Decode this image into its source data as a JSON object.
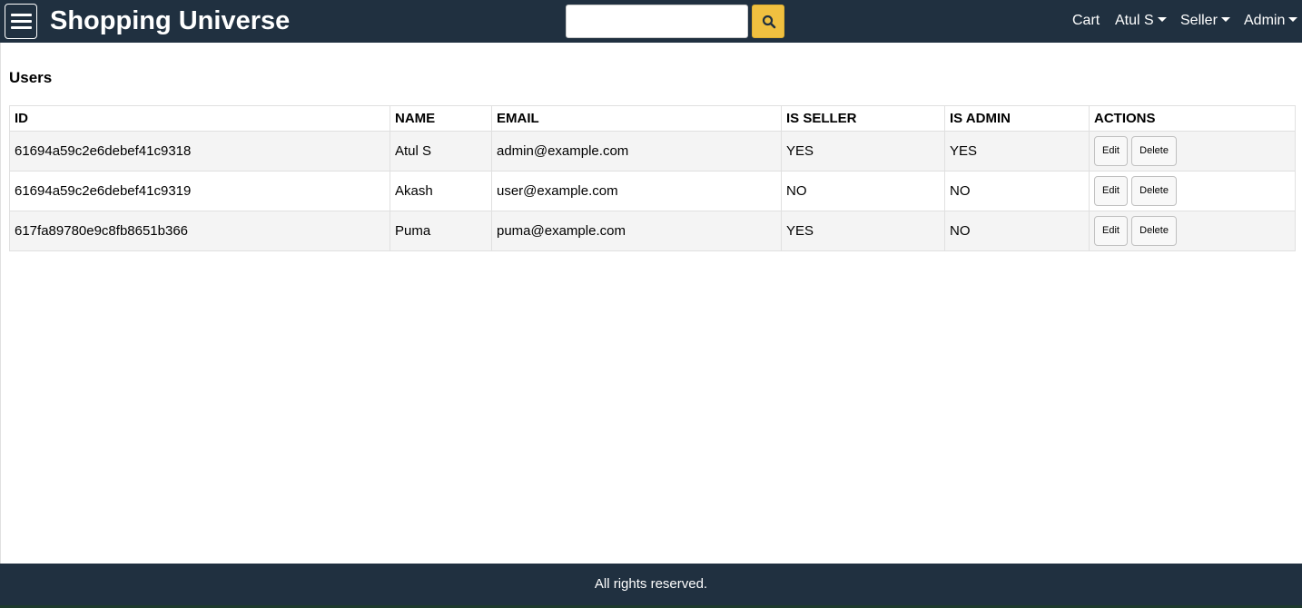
{
  "header": {
    "brand": "Shopping Universe",
    "search": {
      "value": "",
      "placeholder": ""
    },
    "nav": {
      "cart": "Cart",
      "user": "Atul S",
      "seller": "Seller",
      "admin": "Admin"
    }
  },
  "main": {
    "title": "Users",
    "table": {
      "headers": [
        "ID",
        "NAME",
        "EMAIL",
        "IS SELLER",
        "IS ADMIN",
        "ACTIONS"
      ],
      "rows": [
        {
          "id": "61694a59c2e6debef41c9318",
          "name": "Atul S",
          "email": "admin@example.com",
          "is_seller": "YES",
          "is_admin": "YES",
          "edit": "Edit",
          "delete": "Delete"
        },
        {
          "id": "61694a59c2e6debef41c9319",
          "name": "Akash",
          "email": "user@example.com",
          "is_seller": "NO",
          "is_admin": "NO",
          "edit": "Edit",
          "delete": "Delete"
        },
        {
          "id": "617fa89780e9c8fb8651b366",
          "name": "Puma",
          "email": "puma@example.com",
          "is_seller": "YES",
          "is_admin": "NO",
          "edit": "Edit",
          "delete": "Delete"
        }
      ]
    }
  },
  "footer": {
    "text": "All rights reserved."
  },
  "icons": {
    "menu": "hamburger-menu-icon",
    "search": "search-icon",
    "caret": "caret-down-icon"
  },
  "colors": {
    "header_bg": "#203040",
    "search_button": "#f0c040",
    "row_stripe": "#f4f4f4"
  }
}
